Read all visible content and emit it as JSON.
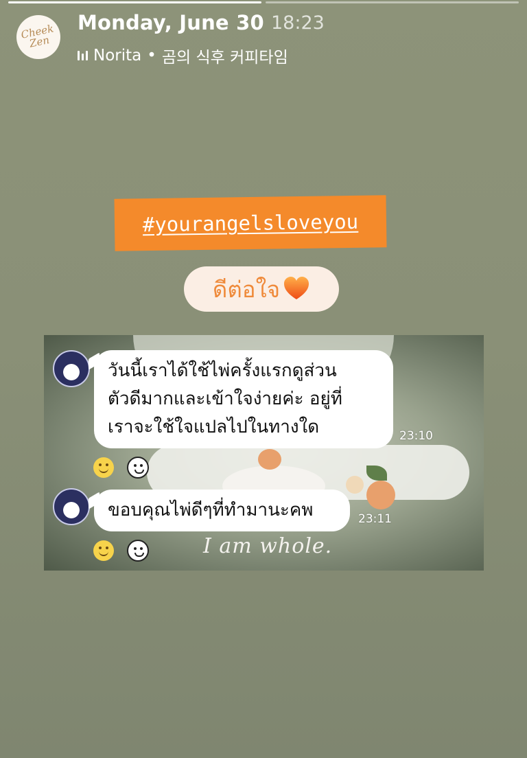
{
  "story": {
    "date": "Monday, June 30",
    "time": "18:23",
    "music": {
      "artist": "Norita",
      "separator": "•",
      "song": "곰의 식후 커피타임"
    },
    "profile_logo_text": "Cheek Zen"
  },
  "stickers": {
    "hashtag": "#yourangelsloveyou",
    "caption": "ดีต่อใจ",
    "heart_icon": "orange-heart-icon"
  },
  "chat": {
    "messages": [
      {
        "lines": [
          "วันนี้เราได้ใช้ไพ่ครั้งแรกดูส่วน",
          "ตัวดีมากและเข้าใจง่ายค่ะ อยู่ที่",
          "เราจะใช้ใจแปลไปในทางใด"
        ],
        "time": "23:10"
      },
      {
        "lines": [
          "ขอบคุณไพ่ดีๆที่ทำมานะคพ"
        ],
        "time": "23:11"
      }
    ],
    "background_quote": "I am whole."
  },
  "colors": {
    "background": "#8a9077",
    "hashtag_bg": "#f48a2b",
    "pill_bg": "#fbeee4",
    "pill_text": "#ef8a3a"
  }
}
